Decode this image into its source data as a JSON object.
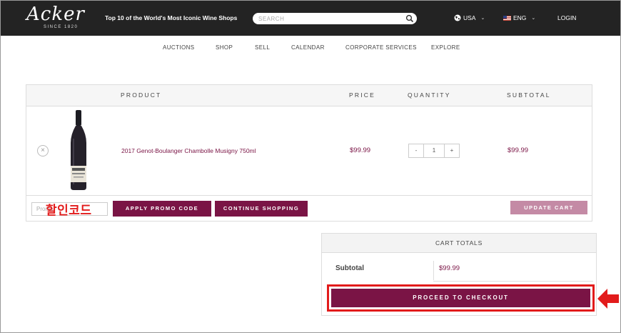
{
  "header": {
    "logo_text": "Acker",
    "logo_since": "SINCE 1820",
    "tagline": "Top 10 of the World's Most Iconic Wine Shops",
    "search_placeholder": "SEARCH",
    "region": "USA",
    "language": "ENG",
    "login": "LOGIN"
  },
  "nav": [
    "AUCTIONS",
    "SHOP",
    "SELL",
    "CALENDAR",
    "CORPORATE SERVICES",
    "EXPLORE"
  ],
  "cart": {
    "columns": [
      "PRODUCT",
      "PRICE",
      "QUANTITY",
      "SUBTOTAL"
    ],
    "items": [
      {
        "name": "2017 Genot-Boulanger Chambolle Musigny 750ml",
        "price": "$99.99",
        "quantity": "1",
        "subtotal": "$99.99",
        "remove": "×",
        "qty_minus": "-",
        "qty_plus": "+"
      }
    ],
    "promo_placeholder": "Promo",
    "promo_overlay": "할인코드",
    "apply_promo": "APPLY PROMO CODE",
    "continue_shopping": "CONTINUE SHOPPING",
    "update_cart": "UPDATE CART"
  },
  "totals": {
    "title": "CART TOTALS",
    "subtotal_label": "Subtotal",
    "subtotal_value": "$99.99",
    "checkout": "PROCEED TO CHECKOUT"
  },
  "colors": {
    "brand": "#7a1445",
    "highlight": "#e21b1b",
    "header_bg": "#232323"
  }
}
